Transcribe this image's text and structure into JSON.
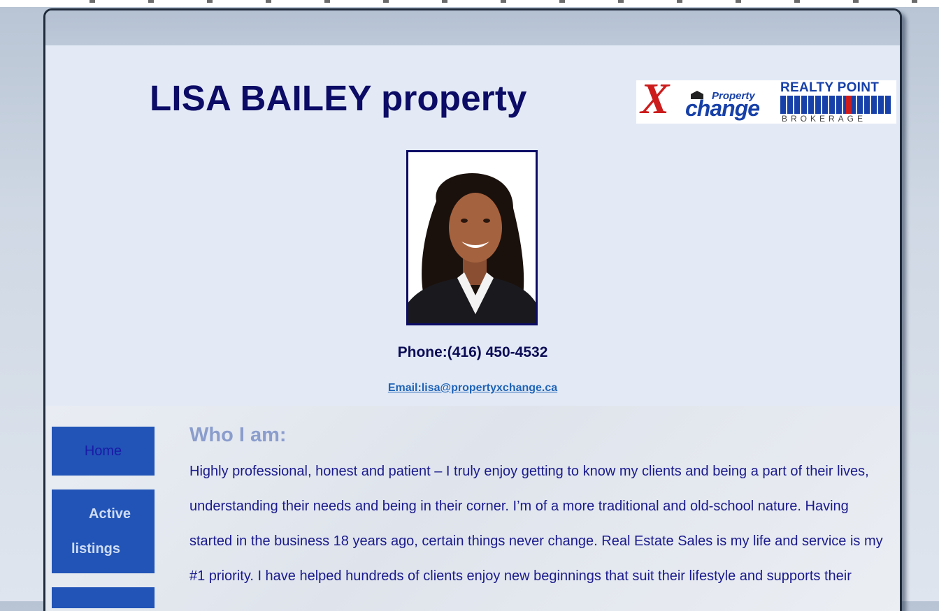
{
  "site": {
    "title": "LISA BAILEY property"
  },
  "logo": {
    "brand_x": "X",
    "brand_top": "Property",
    "brand_bottom": "change",
    "partner_title": "REALTY POINT",
    "partner_sub": "BROKERAGE"
  },
  "contact": {
    "phone": "Phone:(416) 450-4532",
    "email": "Email:lisa@propertyxchange.ca"
  },
  "nav": {
    "items": [
      {
        "label": "Home"
      },
      {
        "label_line1": "Active",
        "label_line2": "listings"
      },
      {
        "label": ""
      }
    ]
  },
  "about": {
    "heading": "Who I am:",
    "body": "Highly professional, honest and patient – I truly enjoy getting to know my clients and being a part of their lives, understanding their needs and being in their corner. I’m of a more traditional and old-school nature. Having started in the business 18 years ago, certain things never change. Real Estate Sales is my life and service is my #1 priority. I have helped hundreds of clients enjoy new beginnings that suit their lifestyle and supports their"
  },
  "colors": {
    "title": "#0c0c66",
    "nav_bg": "#2154b6",
    "heading": "#8a9dcc",
    "body_text": "#1a1a8c",
    "link": "#1f63b6"
  }
}
